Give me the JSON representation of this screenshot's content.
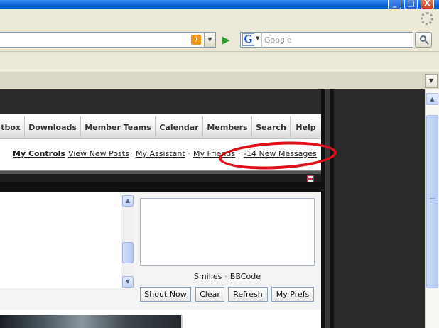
{
  "window": {
    "minimize_glyph": "_",
    "maximize_glyph": "□",
    "close_glyph": "X"
  },
  "toolbar": {
    "search_placeholder": "Google",
    "search_engine_letter": "G",
    "rss_glyph": ")",
    "dropdown_glyph": "▼",
    "go_glyph": "▶"
  },
  "tabs": {
    "list_button_glyph": "▼"
  },
  "forum": {
    "nav_tabs": [
      "tbox",
      "Downloads",
      "Member Teams",
      "Calendar",
      "Members",
      "Search",
      "Help"
    ],
    "user_links": {
      "my_controls": "My Controls",
      "view_new_posts": "View New Posts",
      "my_assistant": "My Assistant",
      "my_friends": "My Friends",
      "new_messages": "-14 New Messages",
      "separator": "·"
    }
  },
  "shoutbox": {
    "smilies_link": "Smilies",
    "bbcode_link": "BBCode",
    "separator": "·",
    "buttons": {
      "shout_now": "Shout Now",
      "clear": "Clear",
      "refresh": "Refresh",
      "my_prefs": "My Prefs"
    },
    "scroll_up_glyph": "▲",
    "scroll_down_glyph": "▼"
  },
  "browser_scroll": {
    "up_glyph": "▲"
  },
  "colors": {
    "highlight_ring": "#e0101a",
    "page_dark": "#2b2b2b",
    "title_bar": "#0a5fd8"
  }
}
